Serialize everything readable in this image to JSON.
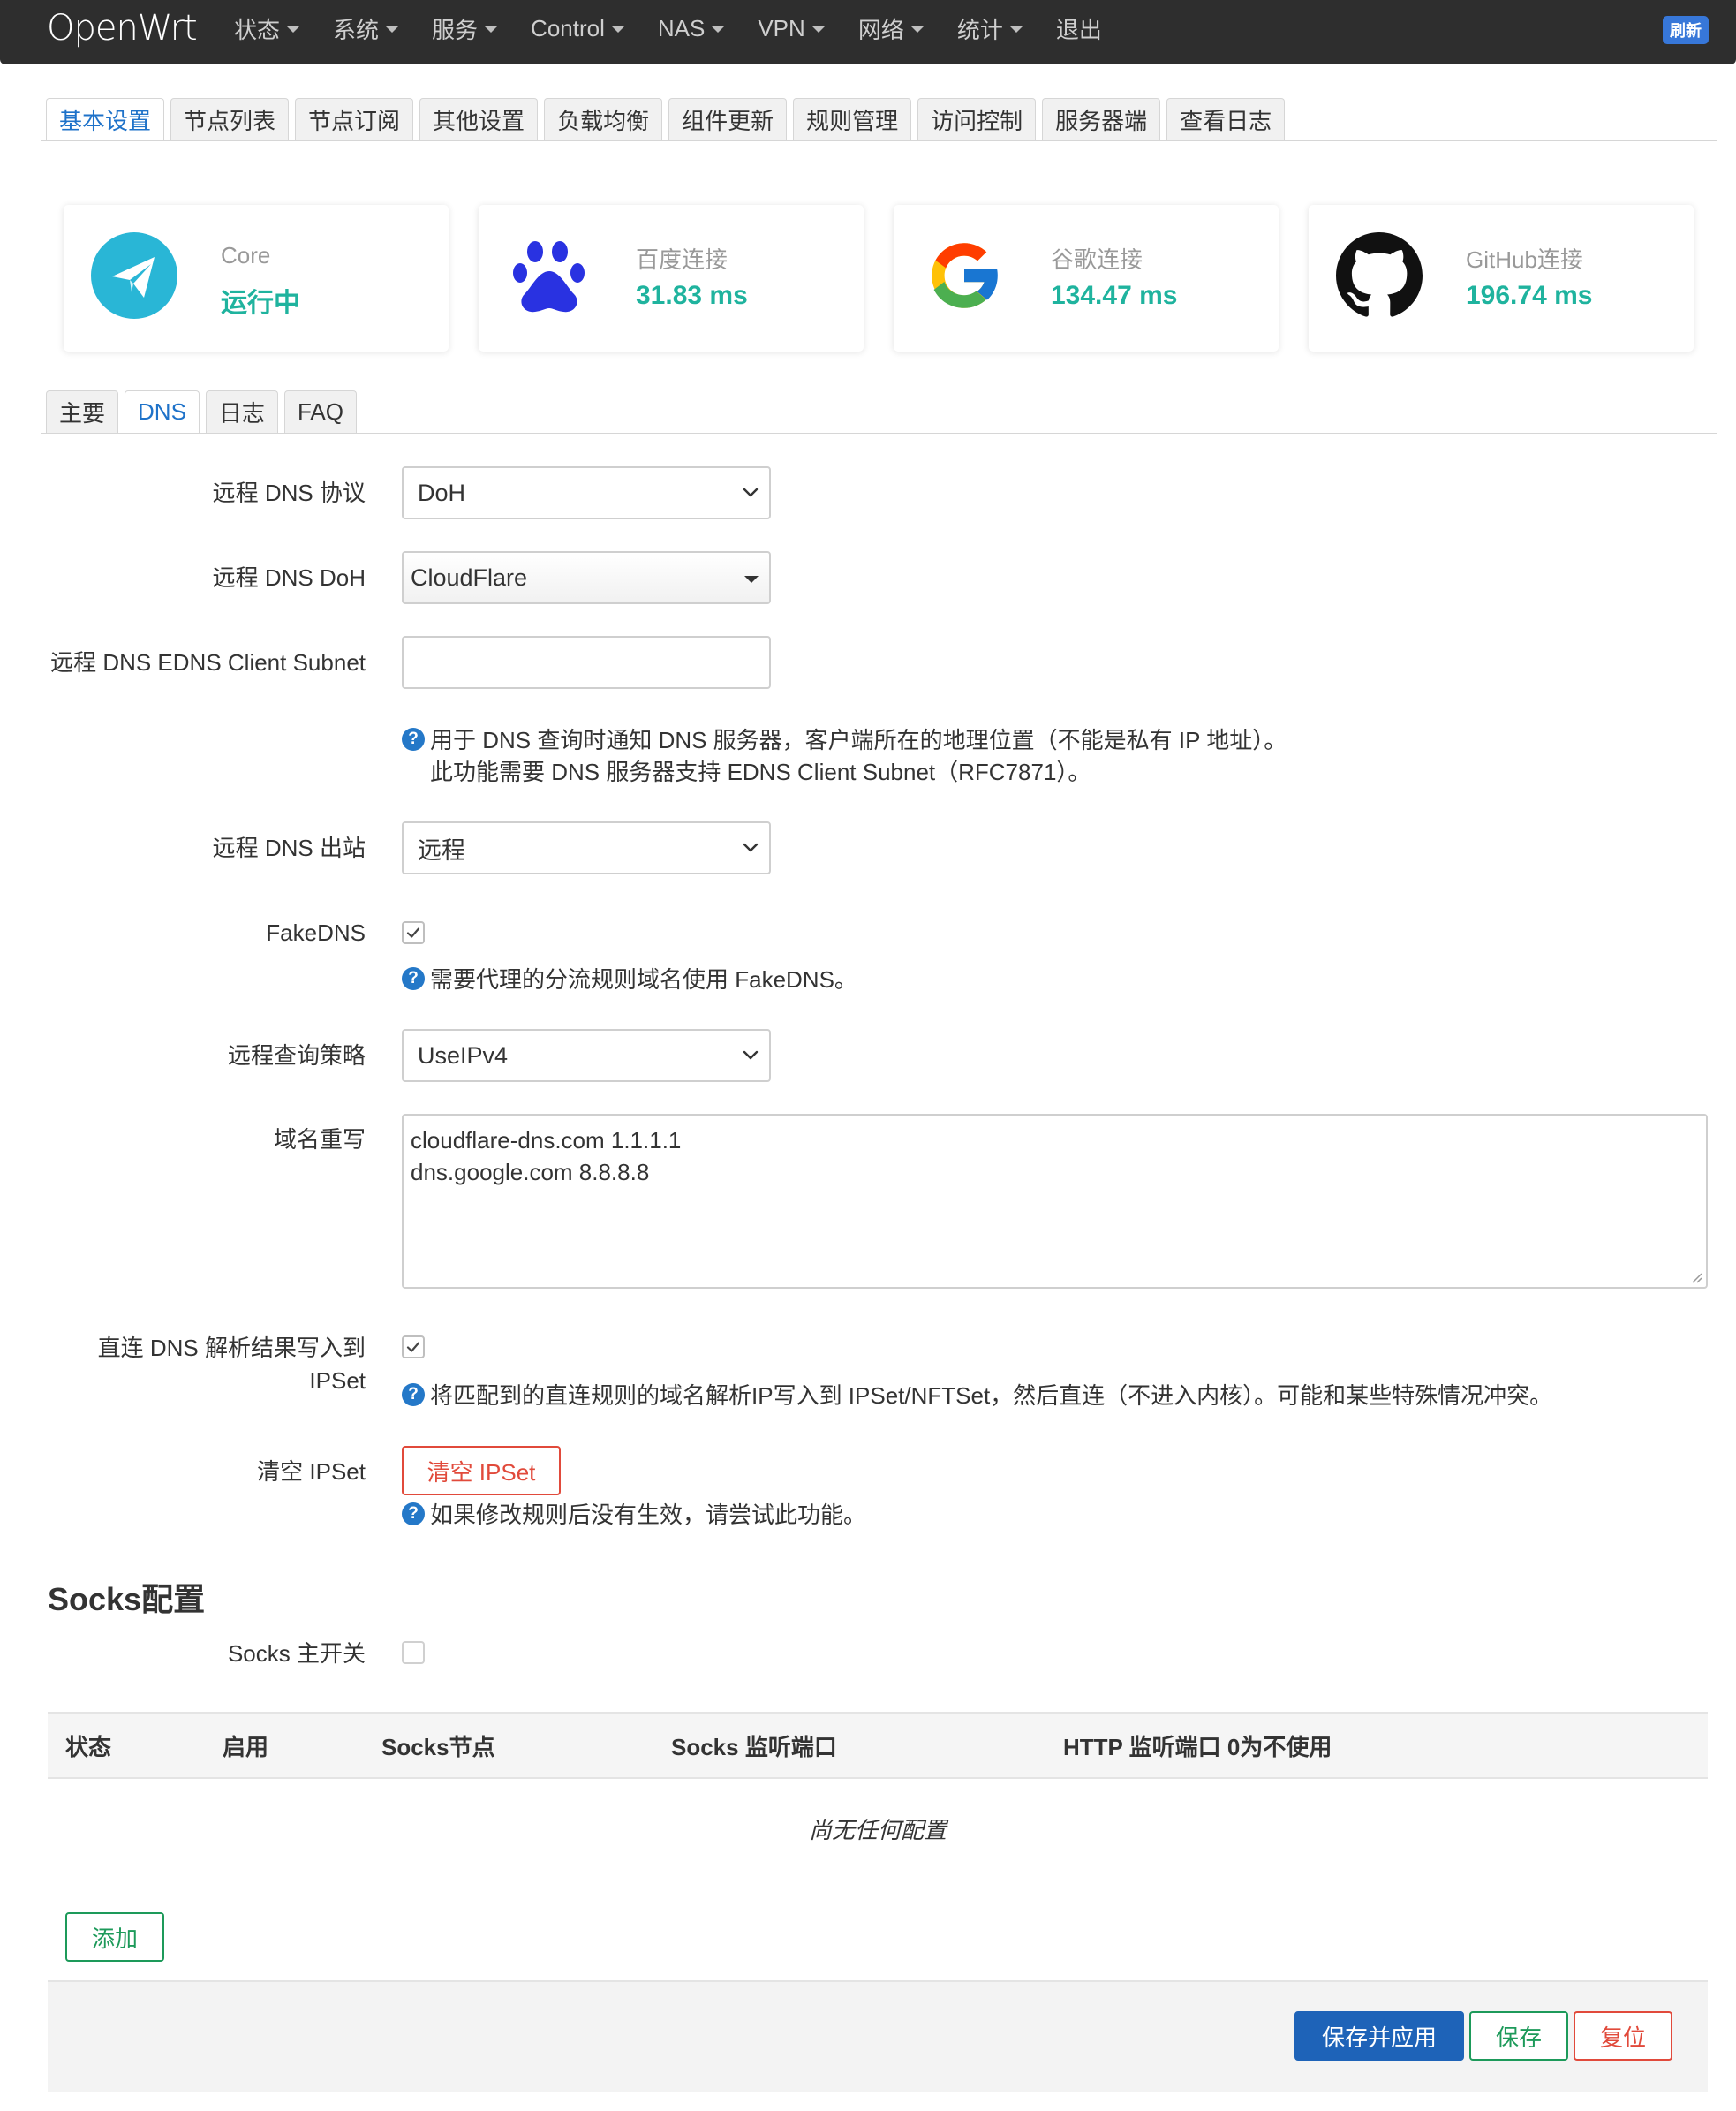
{
  "navbar": {
    "brand": "OpenWrt",
    "menu": [
      {
        "label": "状态",
        "dropdown": true
      },
      {
        "label": "系统",
        "dropdown": true
      },
      {
        "label": "服务",
        "dropdown": true
      },
      {
        "label": "Control",
        "dropdown": true
      },
      {
        "label": "NAS",
        "dropdown": true
      },
      {
        "label": "VPN",
        "dropdown": true
      },
      {
        "label": "网络",
        "dropdown": true
      },
      {
        "label": "统计",
        "dropdown": true
      },
      {
        "label": "退出",
        "dropdown": false
      }
    ],
    "refresh_label": "刷新"
  },
  "main_tabs": [
    "基本设置",
    "节点列表",
    "节点订阅",
    "其他设置",
    "负载均衡",
    "组件更新",
    "规则管理",
    "访问控制",
    "服务器端",
    "查看日志"
  ],
  "status_cards": [
    {
      "label": "Core",
      "value": "运行中",
      "icon": "paper-plane-icon"
    },
    {
      "label": "百度连接",
      "value": "31.83 ms",
      "icon": "baidu-paw-icon"
    },
    {
      "label": "谷歌连接",
      "value": "134.47 ms",
      "icon": "google-icon"
    },
    {
      "label": "GitHub连接",
      "value": "196.74 ms",
      "icon": "github-icon"
    }
  ],
  "sub_tabs": [
    "主要",
    "DNS",
    "日志",
    "FAQ"
  ],
  "form": {
    "remote_dns_protocol": {
      "label": "远程 DNS 协议",
      "value": "DoH"
    },
    "remote_dns_doh": {
      "label": "远程 DNS DoH",
      "value": "CloudFlare"
    },
    "edns_client_subnet": {
      "label": "远程 DNS EDNS Client Subnet",
      "value": "",
      "help_line1": "用于 DNS 查询时通知 DNS 服务器，客户端所在的地理位置（不能是私有 IP 地址）。",
      "help_line2": "此功能需要 DNS 服务器支持 EDNS Client Subnet（RFC7871）。"
    },
    "remote_dns_outbound": {
      "label": "远程 DNS 出站",
      "value": "远程"
    },
    "fakedns": {
      "label": "FakeDNS",
      "checked": true,
      "help": "需要代理的分流规则域名使用 FakeDNS。"
    },
    "query_strategy": {
      "label": "远程查询策略",
      "value": "UseIPv4"
    },
    "domain_rewrite": {
      "label": "域名重写",
      "lines": [
        "cloudflare-dns.com 1.1.1.1",
        "dns.google.com 8.8.8.8"
      ]
    },
    "direct_dns_ipset": {
      "label_line1": "直连 DNS 解析结果写入到",
      "label_line2": "IPSet",
      "checked": true,
      "help": "将匹配到的直连规则的域名解析IP写入到 IPSet/NFTSet，然后直连（不进入内核）。可能和某些特殊情况冲突。"
    },
    "clear_ipset": {
      "label": "清空 IPSet",
      "button": "清空 IPSet",
      "help": "如果修改规则后没有生效，请尝试此功能。"
    }
  },
  "socks": {
    "title": "Socks配置",
    "master_switch": {
      "label": "Socks 主开关",
      "checked": false
    },
    "columns": [
      "状态",
      "启用",
      "Socks节点",
      "Socks 监听端口",
      "HTTP 监听端口 0为不使用"
    ],
    "empty_text": "尚无任何配置",
    "add_button": "添加"
  },
  "footer": {
    "save_apply": "保存并应用",
    "save": "保存",
    "reset": "复位"
  },
  "colors": {
    "accent": "#1e72c9",
    "latency": "#1fb39e",
    "danger": "#e14a3b",
    "success": "#1d9a5a",
    "primary": "#1e63b8"
  }
}
